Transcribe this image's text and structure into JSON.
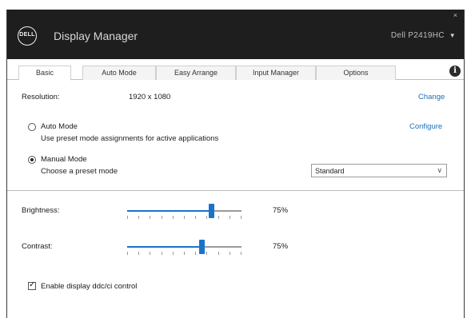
{
  "window": {
    "title": "Display Manager",
    "brand": "DELL",
    "monitor": "Dell P2419HC",
    "close_glyph": "×"
  },
  "tabs": [
    {
      "label": "Basic",
      "active": true
    },
    {
      "label": "Auto Mode",
      "active": false
    },
    {
      "label": "Easy Arrange",
      "active": false
    },
    {
      "label": "Input Manager",
      "active": false
    },
    {
      "label": "Options",
      "active": false
    }
  ],
  "info_icon": "info-icon",
  "resolution": {
    "label": "Resolution:",
    "value": "1920 x 1080",
    "action": "Change"
  },
  "auto_mode": {
    "label": "Auto Mode",
    "description": "Use preset mode assignments for active applications",
    "action": "Configure",
    "selected": false
  },
  "manual_mode": {
    "label": "Manual Mode",
    "description": "Choose a preset mode",
    "selected": true,
    "preset_value": "Standard"
  },
  "brightness": {
    "label": "Brightness:",
    "value_text": "75%",
    "value": 0.75
  },
  "contrast": {
    "label": "Contrast:",
    "value_text": "75%",
    "value": 0.66
  },
  "ddc": {
    "label": "Enable display ddc/ci control",
    "checked": true
  },
  "colors": {
    "accent": "#1a73c8",
    "titlebar": "#1e1e1e",
    "link": "#1a6fb8"
  }
}
